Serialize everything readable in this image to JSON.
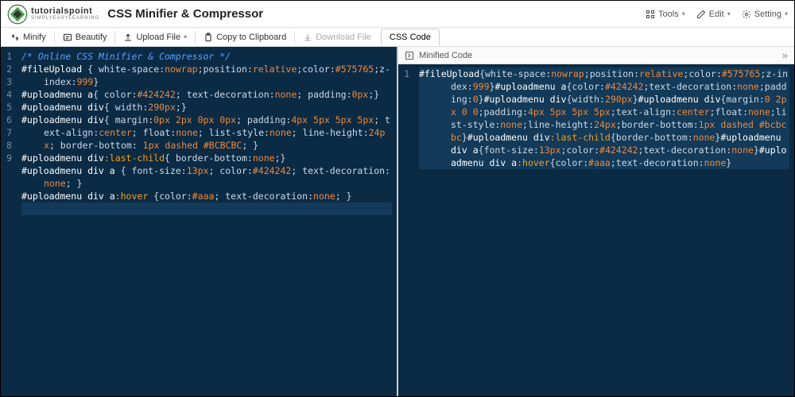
{
  "header": {
    "brand1": "tutorialspoint",
    "brand2": "SIMPLYEASYLEARNING",
    "title": "CSS Minifier & Compressor",
    "tools": "Tools",
    "edit": "Edit",
    "setting": "Setting"
  },
  "toolbar": {
    "minify": "Minify",
    "beautify": "Beautify",
    "upload": "Upload File",
    "copy": "Copy to Clipboard",
    "download": "Download File",
    "tab_css": "CSS Code"
  },
  "paneRight": {
    "title": "Minified Code"
  },
  "leftCode": [
    [
      [
        "comment",
        "/* Online CSS Minifier & Compressor */"
      ]
    ],
    [
      [
        "sel",
        "#fileUpload "
      ],
      [
        "punc",
        "{ "
      ],
      [
        "prop",
        "white-space"
      ],
      [
        "punc",
        ":"
      ],
      [
        "val",
        "nowrap"
      ],
      [
        "punc",
        ";"
      ],
      [
        "prop",
        "position"
      ],
      [
        "punc",
        ":"
      ],
      [
        "val",
        "relative"
      ],
      [
        "punc",
        ";"
      ],
      [
        "prop",
        "color"
      ],
      [
        "punc",
        ":"
      ],
      [
        "val",
        "#575765"
      ],
      [
        "punc",
        ";"
      ],
      [
        "prop",
        "z-index"
      ],
      [
        "punc",
        ":"
      ],
      [
        "num",
        "999"
      ],
      [
        "punc",
        "}"
      ]
    ],
    [
      [
        "sel",
        "#uploadmenu a"
      ],
      [
        "punc",
        "{ "
      ],
      [
        "prop",
        "color"
      ],
      [
        "punc",
        ":"
      ],
      [
        "val",
        "#424242"
      ],
      [
        "punc",
        "; "
      ],
      [
        "prop",
        "text-decoration"
      ],
      [
        "punc",
        ":"
      ],
      [
        "val",
        "none"
      ],
      [
        "punc",
        "; "
      ],
      [
        "prop",
        "padding"
      ],
      [
        "punc",
        ":"
      ],
      [
        "num",
        "0px"
      ],
      [
        "punc",
        ";}"
      ]
    ],
    [
      [
        "sel",
        "#uploadmenu div"
      ],
      [
        "punc",
        "{ "
      ],
      [
        "prop",
        "width"
      ],
      [
        "punc",
        ":"
      ],
      [
        "num",
        "290px"
      ],
      [
        "punc",
        ";}"
      ]
    ],
    [
      [
        "sel",
        "#uploadmenu div"
      ],
      [
        "punc",
        "{ "
      ],
      [
        "prop",
        "margin"
      ],
      [
        "punc",
        ":"
      ],
      [
        "num",
        "0px 2px 0px 0px"
      ],
      [
        "punc",
        "; "
      ],
      [
        "prop",
        "padding"
      ],
      [
        "punc",
        ":"
      ],
      [
        "num",
        "4px 5px 5px 5px"
      ],
      [
        "punc",
        "; "
      ],
      [
        "prop",
        "text-align"
      ],
      [
        "punc",
        ":"
      ],
      [
        "val",
        "center"
      ],
      [
        "punc",
        "; "
      ],
      [
        "prop",
        "float"
      ],
      [
        "punc",
        ":"
      ],
      [
        "val",
        "none"
      ],
      [
        "punc",
        "; "
      ],
      [
        "prop",
        "list-style"
      ],
      [
        "punc",
        ":"
      ],
      [
        "val",
        "none"
      ],
      [
        "punc",
        "; "
      ],
      [
        "prop",
        "line-height"
      ],
      [
        "punc",
        ":"
      ],
      [
        "num",
        "24px"
      ],
      [
        "punc",
        "; "
      ],
      [
        "prop",
        "border-bottom"
      ],
      [
        "punc",
        ": "
      ],
      [
        "num",
        "1px"
      ],
      [
        "punc",
        " "
      ],
      [
        "val",
        "dashed "
      ],
      [
        "val",
        "#BCBCBC"
      ],
      [
        "punc",
        "; }"
      ]
    ],
    [
      [
        "sel",
        "#uploadmenu div"
      ],
      [
        "pseudo",
        ":last-child"
      ],
      [
        "punc",
        "{ "
      ],
      [
        "prop",
        "border-bottom"
      ],
      [
        "punc",
        ":"
      ],
      [
        "val",
        "none"
      ],
      [
        "punc",
        ";}"
      ]
    ],
    [
      [
        "sel",
        "#uploadmenu div a "
      ],
      [
        "punc",
        "{ "
      ],
      [
        "prop",
        "font-size"
      ],
      [
        "punc",
        ":"
      ],
      [
        "num",
        "13px"
      ],
      [
        "punc",
        "; "
      ],
      [
        "prop",
        "color"
      ],
      [
        "punc",
        ":"
      ],
      [
        "val",
        "#424242"
      ],
      [
        "punc",
        "; "
      ],
      [
        "prop",
        "text-decoration"
      ],
      [
        "punc",
        ":"
      ],
      [
        "val",
        "none"
      ],
      [
        "punc",
        "; }"
      ]
    ],
    [
      [
        "sel",
        "#uploadmenu div a"
      ],
      [
        "pseudo",
        ":hover "
      ],
      [
        "punc",
        "{"
      ],
      [
        "prop",
        "color"
      ],
      [
        "punc",
        ":"
      ],
      [
        "val",
        "#aaa"
      ],
      [
        "punc",
        "; "
      ],
      [
        "prop",
        "text-decoration"
      ],
      [
        "punc",
        ":"
      ],
      [
        "val",
        "none"
      ],
      [
        "punc",
        "; }"
      ]
    ],
    [
      [
        "punc",
        ""
      ]
    ]
  ],
  "rightCode": [
    [
      [
        "sel",
        "#fileUpload"
      ],
      [
        "punc",
        "{"
      ],
      [
        "prop",
        "white-space"
      ],
      [
        "punc",
        ":"
      ],
      [
        "val",
        "nowrap"
      ],
      [
        "punc",
        ";"
      ],
      [
        "prop",
        "position"
      ],
      [
        "punc",
        ":"
      ],
      [
        "val",
        "relative"
      ],
      [
        "punc",
        ";"
      ],
      [
        "prop",
        "color"
      ],
      [
        "punc",
        ":"
      ],
      [
        "val",
        "#575765"
      ],
      [
        "punc",
        ";"
      ],
      [
        "prop",
        "z-index"
      ],
      [
        "punc",
        ":"
      ],
      [
        "num",
        "999"
      ],
      [
        "punc",
        "}"
      ],
      [
        "sel",
        "#uploadmenu a"
      ],
      [
        "punc",
        "{"
      ],
      [
        "prop",
        "color"
      ],
      [
        "punc",
        ":"
      ],
      [
        "val",
        "#424242"
      ],
      [
        "punc",
        ";"
      ],
      [
        "prop",
        "text-decoration"
      ],
      [
        "punc",
        ":"
      ],
      [
        "val",
        "none"
      ],
      [
        "punc",
        ";"
      ],
      [
        "prop",
        "padding"
      ],
      [
        "punc",
        ":"
      ],
      [
        "num",
        "0"
      ],
      [
        "punc",
        "}"
      ],
      [
        "sel",
        "#uploadmenu div"
      ],
      [
        "punc",
        "{"
      ],
      [
        "prop",
        "width"
      ],
      [
        "punc",
        ":"
      ],
      [
        "num",
        "290px"
      ],
      [
        "punc",
        "}"
      ],
      [
        "sel",
        "#uploadmenu div"
      ],
      [
        "punc",
        "{"
      ],
      [
        "prop",
        "margin"
      ],
      [
        "punc",
        ":"
      ],
      [
        "num",
        "0 2px 0 0"
      ],
      [
        "punc",
        ";"
      ],
      [
        "prop",
        "padding"
      ],
      [
        "punc",
        ":"
      ],
      [
        "num",
        "4px 5px 5px 5px"
      ],
      [
        "punc",
        ";"
      ],
      [
        "prop",
        "text-align"
      ],
      [
        "punc",
        ":"
      ],
      [
        "val",
        "center"
      ],
      [
        "punc",
        ";"
      ],
      [
        "prop",
        "float"
      ],
      [
        "punc",
        ":"
      ],
      [
        "val",
        "none"
      ],
      [
        "punc",
        ";"
      ],
      [
        "prop",
        "list-style"
      ],
      [
        "punc",
        ":"
      ],
      [
        "val",
        "none"
      ],
      [
        "punc",
        ";"
      ],
      [
        "prop",
        "line-height"
      ],
      [
        "punc",
        ":"
      ],
      [
        "num",
        "24px"
      ],
      [
        "punc",
        ";"
      ],
      [
        "prop",
        "border-bottom"
      ],
      [
        "punc",
        ":"
      ],
      [
        "num",
        "1px"
      ],
      [
        "punc",
        " "
      ],
      [
        "val",
        "dashed "
      ],
      [
        "val",
        "#bcbcbc"
      ],
      [
        "punc",
        "}"
      ],
      [
        "sel",
        "#uploadmenu div"
      ],
      [
        "pseudo",
        ":last-child"
      ],
      [
        "punc",
        "{"
      ],
      [
        "prop",
        "border-bottom"
      ],
      [
        "punc",
        ":"
      ],
      [
        "val",
        "none"
      ],
      [
        "punc",
        "}"
      ],
      [
        "sel",
        "#uploadmenu div a"
      ],
      [
        "punc",
        "{"
      ],
      [
        "prop",
        "font-size"
      ],
      [
        "punc",
        ":"
      ],
      [
        "num",
        "13px"
      ],
      [
        "punc",
        ";"
      ],
      [
        "prop",
        "color"
      ],
      [
        "punc",
        ":"
      ],
      [
        "val",
        "#424242"
      ],
      [
        "punc",
        ";"
      ],
      [
        "prop",
        "text-decoration"
      ],
      [
        "punc",
        ":"
      ],
      [
        "val",
        "none"
      ],
      [
        "punc",
        "}"
      ],
      [
        "sel",
        "#uploadmenu div a"
      ],
      [
        "pseudo",
        ":hover"
      ],
      [
        "punc",
        "{"
      ],
      [
        "prop",
        "color"
      ],
      [
        "punc",
        ":"
      ],
      [
        "val",
        "#aaa"
      ],
      [
        "punc",
        ";"
      ],
      [
        "prop",
        "text-decoration"
      ],
      [
        "punc",
        ":"
      ],
      [
        "val",
        "none"
      ],
      [
        "punc",
        "}"
      ]
    ]
  ]
}
